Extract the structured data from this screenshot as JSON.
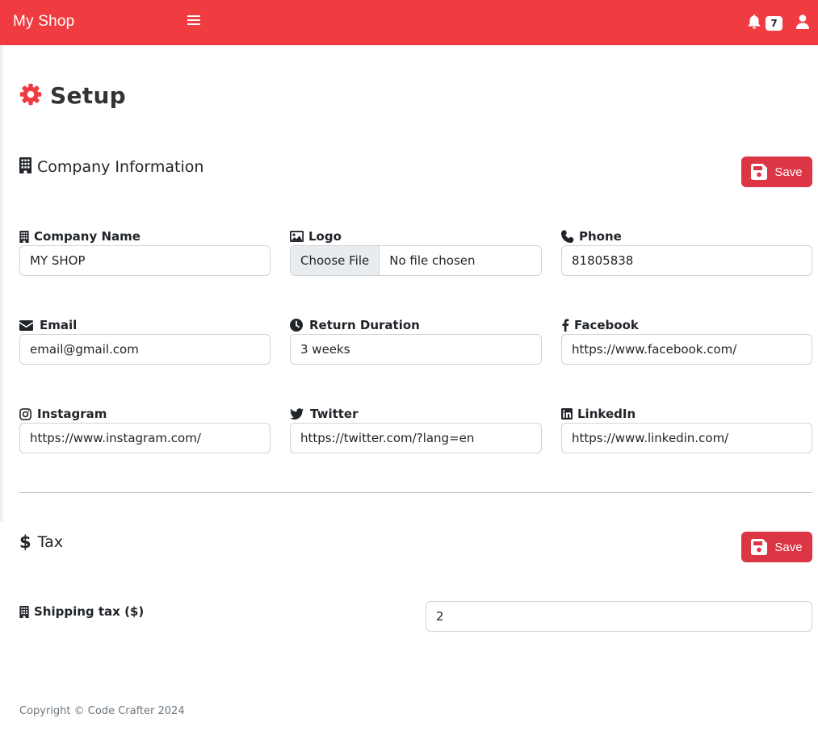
{
  "app": {
    "brand": "My Shop",
    "notification_count": "7"
  },
  "page": {
    "title": "Setup"
  },
  "company": {
    "section_title": "Company Information",
    "save_label": "Save",
    "fields": {
      "company_name": {
        "label": "Company Name",
        "value": "MY SHOP"
      },
      "logo": {
        "label": "Logo",
        "button": "Choose File",
        "status": "No file chosen"
      },
      "phone": {
        "label": "Phone",
        "value": "81805838"
      },
      "email": {
        "label": "Email",
        "value": "email@gmail.com"
      },
      "return_duration": {
        "label": "Return Duration",
        "value": "3 weeks"
      },
      "facebook": {
        "label": "Facebook",
        "value": "https://www.facebook.com/"
      },
      "instagram": {
        "label": "Instagram",
        "value": "https://www.instagram.com/"
      },
      "twitter": {
        "label": "Twitter",
        "value": "https://twitter.com/?lang=en"
      },
      "linkedin": {
        "label": "LinkedIn",
        "value": "https://www.linkedin.com/"
      }
    }
  },
  "tax": {
    "section_title": "Tax",
    "save_label": "Save",
    "shipping_tax": {
      "label": "Shipping tax ($)",
      "value": "2"
    }
  },
  "footer": {
    "text": "Copyright © Code Crafter 2024"
  },
  "colors": {
    "primary": "#f03c40",
    "danger": "#dc3545"
  }
}
